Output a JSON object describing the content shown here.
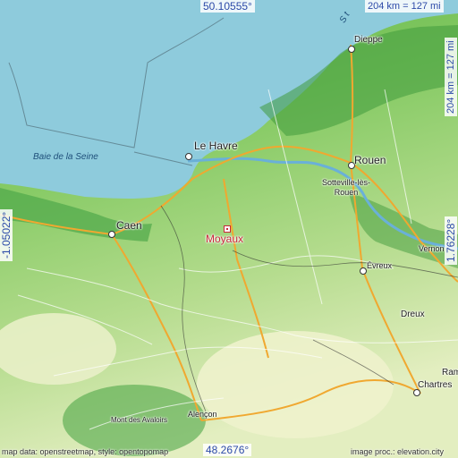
{
  "map": {
    "place": "Moyaux",
    "water": [
      "Baie de la Seine"
    ],
    "s_text": "S t",
    "cities": [
      {
        "id": "dieppe",
        "name": "Dieppe"
      },
      {
        "id": "le-havre",
        "name": "Le Havre"
      },
      {
        "id": "rouen",
        "name": "Rouen"
      },
      {
        "id": "sotteville",
        "name": "Sotteville-lès-\nRouen"
      },
      {
        "id": "caen",
        "name": "Caen"
      },
      {
        "id": "vernon",
        "name": "Vernon"
      },
      {
        "id": "evreux",
        "name": "Évreux"
      },
      {
        "id": "dreux",
        "name": "Dreux"
      },
      {
        "id": "ram",
        "name": "Ram"
      },
      {
        "id": "chartres",
        "name": "Chartres"
      },
      {
        "id": "alencon",
        "name": "Alençon"
      },
      {
        "id": "mont-avaloirs",
        "name": "Mont des Avaloirs"
      }
    ],
    "coords": {
      "top": "50.10555°",
      "bottom": "48.2676°",
      "left": "-1.05022°",
      "right": "1.76228°",
      "scale_h": "204 km = 127 mi",
      "scale_v": "204 km = 127 mi"
    },
    "credits": {
      "left": "map data: openstreetmap, style: opentopomap",
      "right": "image proc.: elevation.city"
    },
    "colors": {
      "sea": "#8ecbdc",
      "land_green": "#7cc65a",
      "dark_green": "#3f9a3c",
      "light_green": "#bfe29a",
      "pale": "#e6efc2",
      "road_major": "#f0a830",
      "accent": "#c8283a",
      "coord_text": "#2c4aa8"
    }
  }
}
